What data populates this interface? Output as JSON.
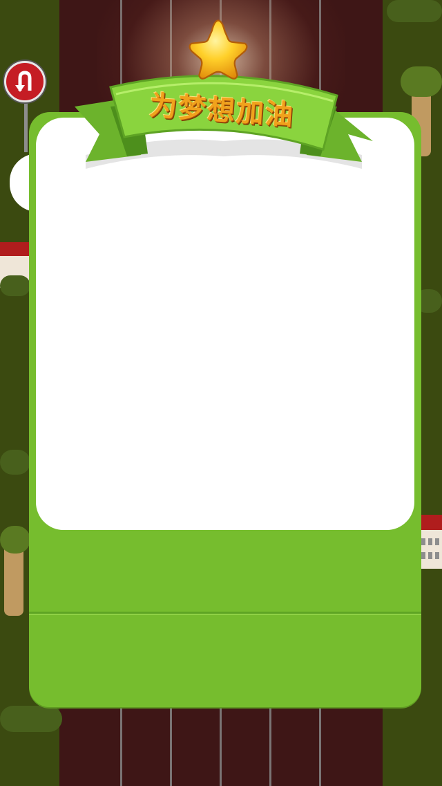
{
  "game": {
    "banner_title": "为梦想加油"
  },
  "icons": {
    "star": "star-icon",
    "sign": "u-turn-sign-icon"
  },
  "colors": {
    "panel_green": "#76bd2e",
    "banner_green": "#8ad43e",
    "track": "#3e1616",
    "grass": "#3b4a10",
    "star_gold": "#ffc21f",
    "title_orange": "#f0a21c"
  }
}
